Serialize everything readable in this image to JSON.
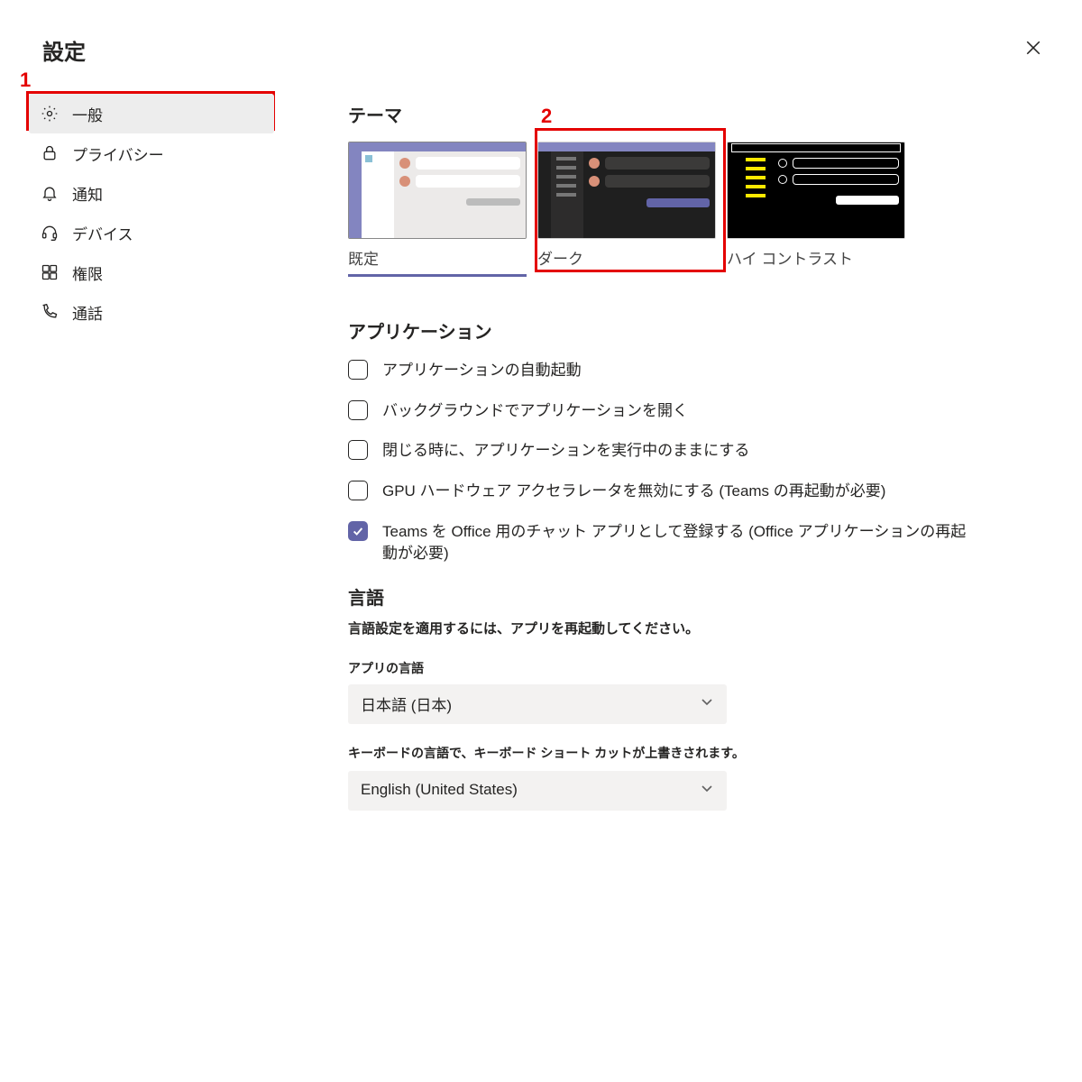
{
  "title": "設定",
  "annotations": {
    "one": "1",
    "two": "2"
  },
  "sidebar": {
    "items": [
      {
        "label": "一般"
      },
      {
        "label": "プライバシー"
      },
      {
        "label": "通知"
      },
      {
        "label": "デバイス"
      },
      {
        "label": "権限"
      },
      {
        "label": "通話"
      }
    ]
  },
  "theme": {
    "heading": "テーマ",
    "options": [
      {
        "label": "既定"
      },
      {
        "label": "ダーク"
      },
      {
        "label": "ハイ コントラスト"
      }
    ]
  },
  "application": {
    "heading": "アプリケーション",
    "checkboxes": [
      {
        "label": "アプリケーションの自動起動",
        "checked": false
      },
      {
        "label": "バックグラウンドでアプリケーションを開く",
        "checked": false
      },
      {
        "label": "閉じる時に、アプリケーションを実行中のままにする",
        "checked": false
      },
      {
        "label": "GPU ハードウェア アクセラレータを無効にする (Teams の再起動が必要)",
        "checked": false
      },
      {
        "label": "Teams を Office 用のチャット アプリとして登録する (Office アプリケーションの再起動が必要)",
        "checked": true
      }
    ]
  },
  "language": {
    "heading": "言語",
    "note": "言語設定を適用するには、アプリを再起動してください。",
    "app_lang_label": "アプリの言語",
    "app_lang_value": "日本語 (日本)",
    "keyboard_label": "キーボードの言語で、キーボード ショート カットが上書きされます。",
    "keyboard_value": "English (United States)"
  }
}
